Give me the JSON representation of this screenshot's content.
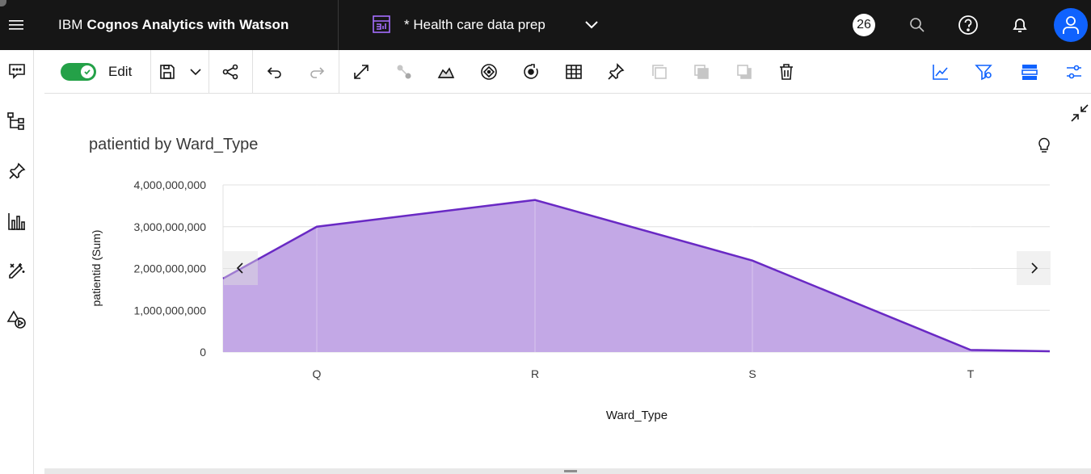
{
  "header": {
    "brand_prefix": "IBM",
    "brand_product": "Cognos Analytics with Watson",
    "document_title": "* Health care data prep",
    "notifications_count": "26"
  },
  "toolbar": {
    "edit_label": "Edit",
    "edit_on": true
  },
  "icons": {
    "header": [
      "menu-icon",
      "dashboard-doc-icon",
      "chevron-down-icon",
      "search-icon",
      "help-icon",
      "notification-icon",
      "user-icon"
    ],
    "left_rail": [
      "comment-icon",
      "data-tree-icon",
      "pin-icon",
      "visualizations-icon",
      "assistant-icon",
      "widgets-icon"
    ],
    "toolbar": [
      "save-icon",
      "save-dropdown-icon",
      "share-icon",
      "undo-icon",
      "redo-icon",
      "focus-icon",
      "connections-icon",
      "areas-icon",
      "navigation-paths-icon",
      "drill-icon",
      "table-icon",
      "pin-icon",
      "copy-icon",
      "duplicate-icon",
      "bring-front-icon",
      "delete-icon",
      "forecast-icon",
      "filter-icon",
      "properties-icon",
      "settings-icon"
    ]
  },
  "colors": {
    "accent": "#0f62fe",
    "toggle_on": "#24a148",
    "series_line": "#6929c4",
    "series_fill": "#c3a8e6"
  },
  "chart_data": {
    "type": "area",
    "title": "patientid by Ward_Type",
    "xlabel": "Ward_Type",
    "ylabel": "patientid (Sum)",
    "categories": [
      "Q",
      "R",
      "S",
      "T"
    ],
    "series": [
      {
        "values": [
          3000000000,
          3640000000,
          2190000000,
          50000000
        ]
      }
    ],
    "leading_value": 1760000000,
    "trailing_value": 20000000,
    "ylim": [
      0,
      4000000000
    ],
    "yticks": [
      "4,000,000,000",
      "3,000,000,000",
      "2,000,000,000",
      "1,000,000,000",
      "0"
    ],
    "grid": true,
    "legend": "none"
  }
}
